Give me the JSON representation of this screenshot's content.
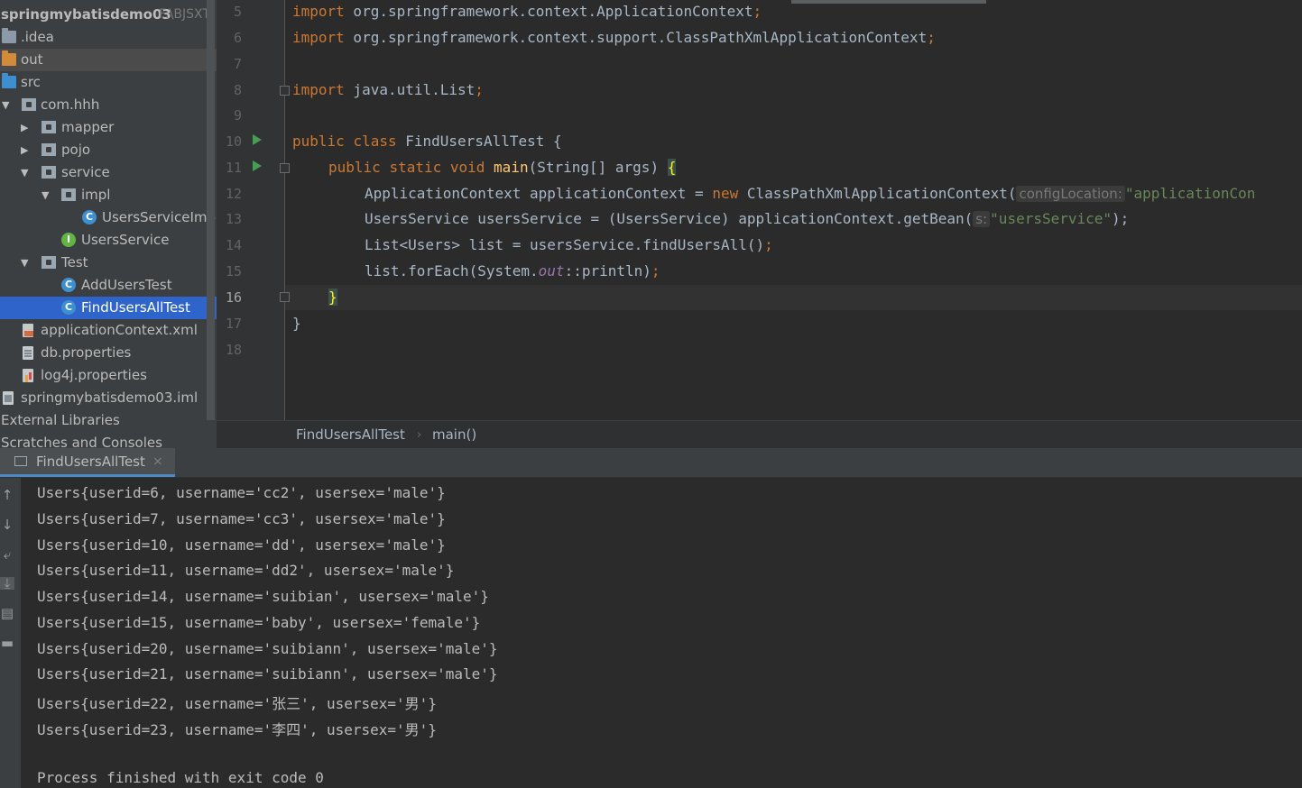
{
  "project": {
    "root_name": "springmybatisdemo03",
    "root_path": "F:\\BJSXT",
    "items": [
      {
        "label": "idea",
        "display": ".idea"
      },
      {
        "label": "out"
      },
      {
        "label": "src"
      },
      {
        "label": "com.hhh"
      },
      {
        "label": "mapper"
      },
      {
        "label": "pojo"
      },
      {
        "label": "service"
      },
      {
        "label": "impl"
      },
      {
        "label": "UsersServiceImpl"
      },
      {
        "label": "UsersService"
      },
      {
        "label": "Test"
      },
      {
        "label": "AddUsersTest"
      },
      {
        "label": "FindUsersAllTest"
      },
      {
        "label": "applicationContext.xml"
      },
      {
        "label": "db.properties"
      },
      {
        "label": "log4j.properties"
      },
      {
        "label": "springmybatisdemo03.iml"
      },
      {
        "label": "External Libraries"
      },
      {
        "label": "Scratches and Consoles"
      }
    ]
  },
  "editor": {
    "line_numbers": [
      "5",
      "6",
      "7",
      "8",
      "9",
      "10",
      "11",
      "12",
      "13",
      "14",
      "15",
      "16",
      "17",
      "18"
    ],
    "lines": {
      "l5": {
        "kw": "import",
        "rest": " org.springframework.context.ApplicationContext",
        "semi": ";"
      },
      "l6": {
        "kw": "import",
        "rest": " org.springframework.context.support.ClassPathXmlApplicationContext",
        "semi": ";"
      },
      "l8": {
        "kw": "import",
        "rest": " java.util.List",
        "semi": ";"
      },
      "l10": {
        "kw1": "public",
        "kw2": "class",
        "name": "FindUsersAllTest",
        "brace": "{"
      },
      "l11": {
        "kw1": "public",
        "kw2": "static",
        "kw3": "void",
        "fn": "main",
        "params": "(String[] args) ",
        "brace": "{"
      },
      "l12": {
        "pre": "ApplicationContext applicationContext = ",
        "kw": "new",
        "mid": " ClassPathXmlApplicationContext(",
        "hint": "configLocation:",
        "str": "\"applicationCon"
      },
      "l13": {
        "pre": "UsersService usersService = (UsersService) applicationContext.getBean(",
        "hint": "s:",
        "str": "\"usersService\"",
        "post": ");"
      },
      "l14": {
        "pre": "List<Users> list = usersService.findUsersAll()",
        "semi": ";"
      },
      "l15": {
        "pre": "list.forEach(System.",
        "stat": "out",
        "post": "::println)",
        "semi": ";"
      },
      "l16": {
        "brace": "}"
      },
      "l17": {
        "brace": "}"
      }
    }
  },
  "breadcrumb": {
    "class_name": "FindUsersAllTest",
    "separator": "›",
    "method": "main()"
  },
  "run": {
    "tab_label": "FindUsersAllTest",
    "close": "×",
    "output": [
      "Users{userid=6, username='cc2', usersex='male'}",
      "Users{userid=7, username='cc3', usersex='male'}",
      "Users{userid=10, username='dd', usersex='male'}",
      "Users{userid=11, username='dd2', usersex='male'}",
      "Users{userid=14, username='suibian', usersex='male'}",
      "Users{userid=15, username='baby', usersex='female'}",
      "Users{userid=20, username='suibiann', usersex='male'}",
      "Users{userid=21, username='suibiann', usersex='male'}",
      "Users{userid=22, username='张三', usersex='男'}",
      "Users{userid=23, username='李四', usersex='男'}"
    ],
    "finished": "Process finished with exit code 0"
  },
  "icons": {
    "class": "C",
    "interface": "I",
    "expanded": "▼",
    "collapsed": "▶",
    "up": "↑",
    "down": "↓",
    "wrap": "⤶",
    "scroll_end": "⤓",
    "print": "▤",
    "trash": "▬"
  }
}
